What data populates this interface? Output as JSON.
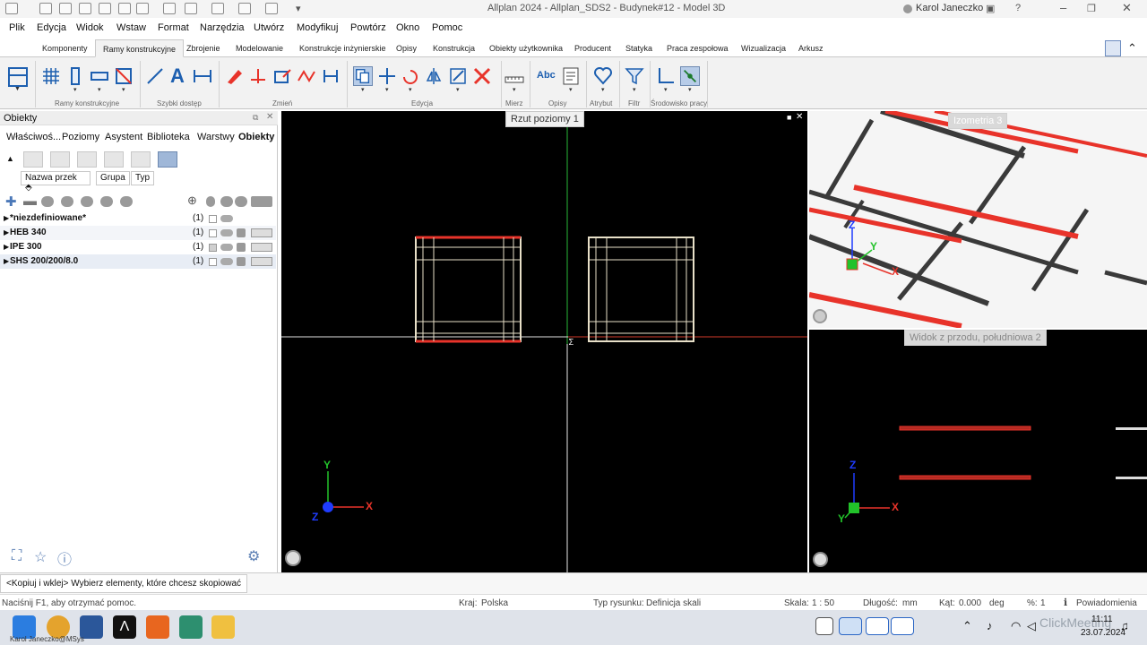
{
  "window": {
    "title": "Allplan 2024 - Allplan_SDS2 - Budynek#12 - Model 3D",
    "user": "Karol Janeczko"
  },
  "menu": [
    "Plik",
    "Edycja",
    "Widok",
    "Wstaw",
    "Format",
    "Narzędzia",
    "Utwórz",
    "Modyfikuj",
    "Powtórz",
    "Okno",
    "Pomoc"
  ],
  "tabs": [
    "Komponenty",
    "Ramy konstrukcyjne",
    "Zbrojenie",
    "Modelowanie",
    "Konstrukcje inżynierskie",
    "Opisy",
    "Konstrukcja",
    "Obiekty użytkownika",
    "Producent",
    "Statyka",
    "Praca zespołowa",
    "Wizualizacja",
    "Arkusz"
  ],
  "active_tab": "Ramy konstrukcyjne",
  "ribbon_groups": [
    "Ramy konstrukcyjne",
    "Szybki dostęp",
    "Zmień",
    "Edycja",
    "Mierz",
    "Opisy",
    "Atrybut",
    "Filtr",
    "Środowisko pracy"
  ],
  "panel": {
    "title": "Obiekty",
    "tabs": [
      "Właściwoś...",
      "Poziomy",
      "Asystent",
      "Biblioteka",
      "Warstwy",
      "Obiekty"
    ],
    "chips": [
      "Nazwa przek",
      "Grupa",
      "Typ"
    ],
    "rows": [
      {
        "name": "*niezdefiniowane*",
        "count": "(1)"
      },
      {
        "name": "HEB 340",
        "count": "(1)"
      },
      {
        "name": "IPE 300",
        "count": "(1)"
      },
      {
        "name": "SHS 200/200/8.0",
        "count": "(1)"
      }
    ]
  },
  "viewports": {
    "plan": "Rzut poziomy 1",
    "iso": "Izometria 3",
    "front": "Widok z przodu, południowa 2"
  },
  "axes": {
    "x": "X",
    "y": "Y",
    "z": "Z"
  },
  "command": "<Kopiuj i wklej> Wybierz elementy, które chcesz skopiować",
  "status": {
    "help": "Naciśnij F1, aby otrzymać pomoc.",
    "country_label": "Kraj:",
    "country": "Polska",
    "drawing_type_label": "Typ rysunku:",
    "drawing_type": "Definicja skali",
    "scale_label": "Skala:",
    "scale": "1 : 50",
    "length_label": "Długość:",
    "length_unit": "mm",
    "angle_label": "Kąt:",
    "angle": "0.000",
    "angle_unit": "deg",
    "percent_label": "%:",
    "percent": "1",
    "notifications": "Powiadomienia"
  },
  "taskbar": {
    "user_label": "Karol Janeczko@MSys",
    "time": "11:11",
    "date": "23.07.2024",
    "watermark": "ClickMeeting"
  },
  "colors": {
    "accent_red": "#e8332a",
    "axis_green": "#22c22a",
    "axis_blue": "#1f3cff",
    "viewport_bg": "#000000"
  }
}
